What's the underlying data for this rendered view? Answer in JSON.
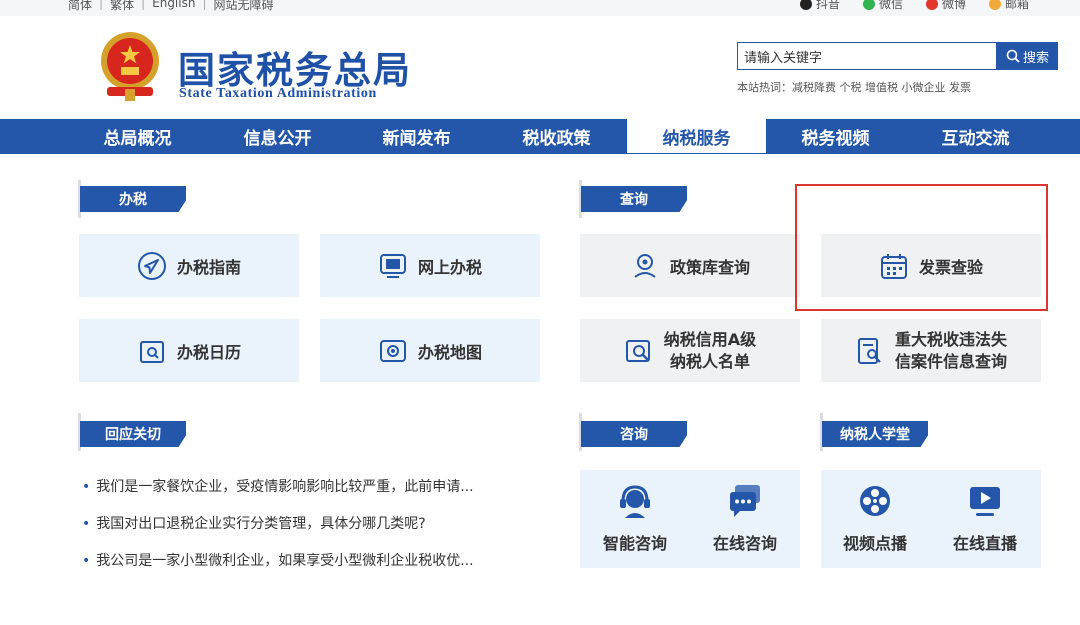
{
  "topbar": {
    "links": [
      "简体",
      "繁体",
      "English",
      "网站无障碍"
    ],
    "social": [
      {
        "label": "抖音",
        "icon": "douyin-icon",
        "color": "#222222"
      },
      {
        "label": "微信",
        "icon": "wechat-icon",
        "color": "#2fb450"
      },
      {
        "label": "微博",
        "icon": "weibo-icon",
        "color": "#e2372c"
      },
      {
        "label": "邮箱",
        "icon": "mail-icon",
        "color": "#f2a93b"
      }
    ]
  },
  "header": {
    "site_name": "国家税务总局",
    "site_name_en": "State Taxation Administration",
    "search_value": "请输入关键字",
    "search_button": "搜索",
    "hotwords": "本站热词：减税降费 个税 增值税 小微企业 发票"
  },
  "nav": {
    "items": [
      "总局概况",
      "信息公开",
      "新闻发布",
      "税收政策",
      "纳税服务",
      "税务视频",
      "互动交流"
    ],
    "active": "纳税服务"
  },
  "sections": {
    "banshui": {
      "title": "办税",
      "tiles": [
        "办税指南",
        "网上办税",
        "办税日历",
        "办税地图"
      ]
    },
    "chaxun": {
      "title": "查询",
      "tiles": [
        {
          "line1": "政策库查询",
          "line2": ""
        },
        {
          "line1": "发票查验",
          "line2": ""
        },
        {
          "line1": "纳税信用A级",
          "line2": "纳税人名单"
        },
        {
          "line1": "重大税收违法失",
          "line2": "信案件信息查询"
        }
      ]
    },
    "huiying": {
      "title": "回应关切",
      "items": [
        "我们是一家餐饮企业，受疫情影响影响比较严重，此前申请...",
        "我国对出口退税企业实行分类管理，具体分哪几类呢?",
        "我公司是一家小型微利企业，如果享受小型微利企业税收优..."
      ]
    },
    "zixun": {
      "title": "咨询",
      "items": [
        "智能咨询",
        "在线咨询"
      ]
    },
    "xuetang": {
      "title": "纳税人学堂",
      "items": [
        "视频点播",
        "在线直播"
      ]
    }
  },
  "colors": {
    "brand": "#2457a9",
    "tile_blue": "#eaf2fb",
    "tile_gray": "#f0f1f3",
    "highlight": "#d9362f"
  }
}
